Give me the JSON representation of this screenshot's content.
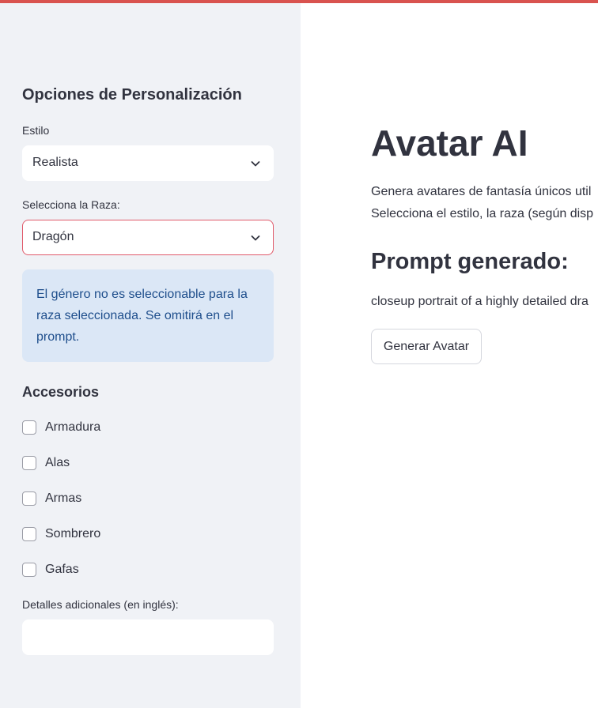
{
  "sidebar": {
    "title": "Opciones de Personalización",
    "style_label": "Estilo",
    "style_value": "Realista",
    "race_label": "Selecciona la Raza:",
    "race_value": "Dragón",
    "info_lines": [
      "El género no es seleccionable para la",
      "raza seleccionada. Se omitirá en el",
      "prompt."
    ],
    "accessories_title": "Accesorios",
    "accessories": [
      {
        "label": "Armadura",
        "checked": false
      },
      {
        "label": "Alas",
        "checked": false
      },
      {
        "label": "Armas",
        "checked": false
      },
      {
        "label": "Sombrero",
        "checked": false
      },
      {
        "label": "Gafas",
        "checked": false
      }
    ],
    "details_label": "Detalles adicionales (en inglés):",
    "details_value": ""
  },
  "main": {
    "title": "Avatar AI",
    "description_lines": [
      "Genera avatares de fantasía únicos util",
      "Selecciona el estilo, la raza (según disp"
    ],
    "prompt_title": "Prompt generado:",
    "prompt_text": "closeup portrait of a highly detailed dra",
    "generate_button": "Generar Avatar"
  },
  "colors": {
    "sidebar_bg": "#f0f2f6",
    "accent_top": "#d9534f",
    "active_border": "#e05a6a",
    "info_bg": "#dbe7f6",
    "info_text": "#1e4e8c",
    "text": "#31333f"
  },
  "icons": {
    "select_arrow": "chevron-down-icon"
  }
}
